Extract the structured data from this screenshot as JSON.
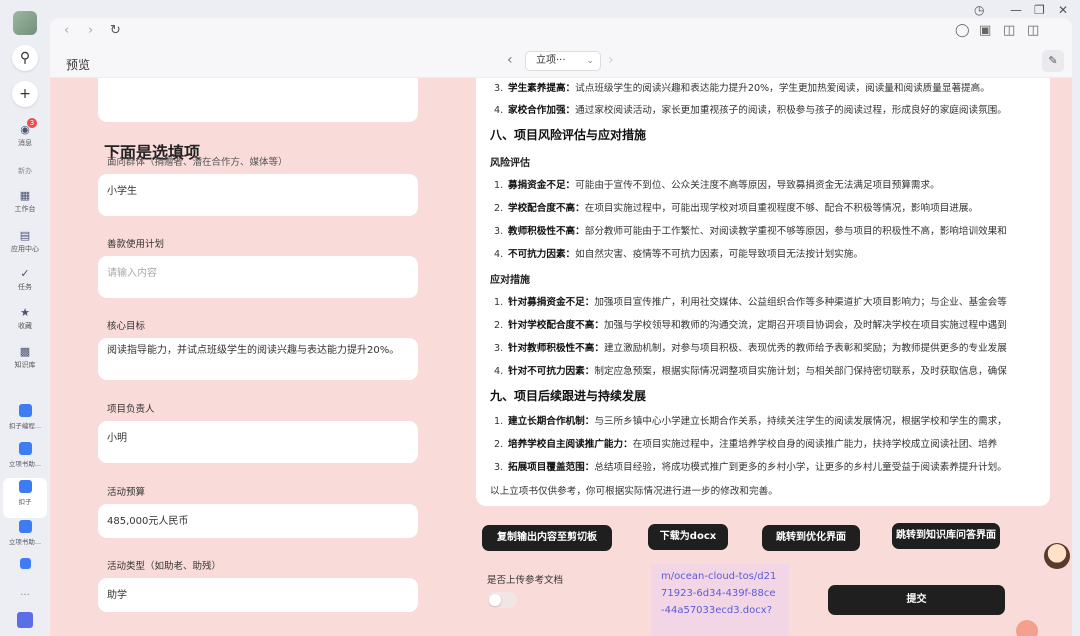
{
  "sidebar": {
    "items": [
      {
        "label": "消息",
        "icon": "message-icon",
        "badge": "3"
      },
      {
        "label": "新办",
        "icon": "none"
      },
      {
        "label": "工作台",
        "icon": "workbench-icon"
      },
      {
        "label": "应用中心",
        "icon": "app-center-icon"
      },
      {
        "label": "任务",
        "icon": "task-icon"
      },
      {
        "label": "收藏",
        "icon": "star-icon"
      },
      {
        "label": "知识库",
        "icon": "knowledge-icon"
      }
    ],
    "apps": [
      {
        "label": "扣子编程..."
      },
      {
        "label": "立项书助..."
      },
      {
        "label": "扣子"
      },
      {
        "label": "立项书助..."
      }
    ]
  },
  "toolbar": {
    "preview_label": "预览",
    "pager_value": "立项···"
  },
  "form": {
    "section_title": "下面是选填项",
    "fields": [
      {
        "label": "面向群体（捐赠者、潜在合作方、媒体等）",
        "value": "小学生",
        "placeholder": ""
      },
      {
        "label": "善款使用计划",
        "value": "",
        "placeholder": "请输入内容"
      },
      {
        "label": "核心目标",
        "value": "阅读指导能力，并试点班级学生的阅读兴趣与表达能力提升20%。",
        "placeholder": ""
      },
      {
        "label": "项目负责人",
        "value": "小明",
        "placeholder": ""
      },
      {
        "label": "活动预算",
        "value": "485,000元人民币",
        "placeholder": ""
      },
      {
        "label": "活动类型（如助老、助残）",
        "value": "助学",
        "placeholder": ""
      }
    ],
    "top_line": "..."
  },
  "doc": {
    "lines": [
      {
        "n": "3.",
        "bold": "学生素养提高：",
        "text": "试点班级学生的阅读兴趣和表达能力提升20%，学生更加热爱阅读，阅读量和阅读质量显著提高。"
      },
      {
        "n": "4.",
        "bold": "家校合作加强：",
        "text": "通过家校阅读活动，家长更加重视孩子的阅读，积极参与孩子的阅读过程，形成良好的家庭阅读氛围。"
      }
    ],
    "h8": "八、项目风险评估与应对措施",
    "risk_title": "风险评估",
    "risks": [
      {
        "n": "1.",
        "bold": "募捐资金不足：",
        "text": "可能由于宣传不到位、公众关注度不高等原因，导致募捐资金无法满足项目预算需求。"
      },
      {
        "n": "2.",
        "bold": "学校配合度不高：",
        "text": "在项目实施过程中，可能出现学校对项目重视程度不够、配合不积极等情况，影响项目进展。"
      },
      {
        "n": "3.",
        "bold": "教师积极性不高：",
        "text": "部分教师可能由于工作繁忙、对阅读教学重视不够等原因，参与项目的积极性不高，影响培训效果和"
      },
      {
        "n": "4.",
        "bold": "不可抗力因素：",
        "text": "如自然灾害、疫情等不可抗力因素，可能导致项目无法按计划实施。"
      }
    ],
    "measure_title": "应对措施",
    "measures": [
      {
        "n": "1.",
        "bold": "针对募捐资金不足：",
        "text": "加强项目宣传推广，利用社交媒体、公益组织合作等多种渠道扩大项目影响力；与企业、基金会等"
      },
      {
        "n": "2.",
        "bold": "针对学校配合度不高：",
        "text": "加强与学校领导和教师的沟通交流，定期召开项目协调会，及时解决学校在项目实施过程中遇到"
      },
      {
        "n": "3.",
        "bold": "针对教师积极性不高：",
        "text": "建立激励机制，对参与项目积极、表现优秀的教师给予表彰和奖励；为教师提供更多的专业发展"
      },
      {
        "n": "4.",
        "bold": "针对不可抗力因素：",
        "text": "制定应急预案，根据实际情况调整项目实施计划；与相关部门保持密切联系，及时获取信息，确保"
      }
    ],
    "h9": "九、项目后续跟进与持续发展",
    "follow": [
      {
        "n": "1.",
        "bold": "建立长期合作机制：",
        "text": "与三所乡镇中心小学建立长期合作关系，持续关注学生的阅读发展情况，根据学校和学生的需求，"
      },
      {
        "n": "2.",
        "bold": "培养学校自主阅读推广能力：",
        "text": "在项目实施过程中，注重培养学校自身的阅读推广能力，扶持学校成立阅读社团、培养"
      },
      {
        "n": "3.",
        "bold": "拓展项目覆盖范围：",
        "text": "总结项目经验，将成功模式推广到更多的乡村小学，让更多的乡村儿童受益于阅读素养提升计划。"
      }
    ],
    "footer": "以上立项书仅供参考，你可根据实际情况进行进一步的修改和完善。"
  },
  "actions": {
    "copy": "复制输出内容至剪切板",
    "download": "下载为docx",
    "optimize": "跳转到优化界面",
    "kb": "跳转到知识库问答界面",
    "upload_label": "是否上传参考文档",
    "link": "m/ocean-cloud-tos/d2171923-6d34-439f-88ce-44a57033ecd3.docx?",
    "submit": "提交"
  }
}
